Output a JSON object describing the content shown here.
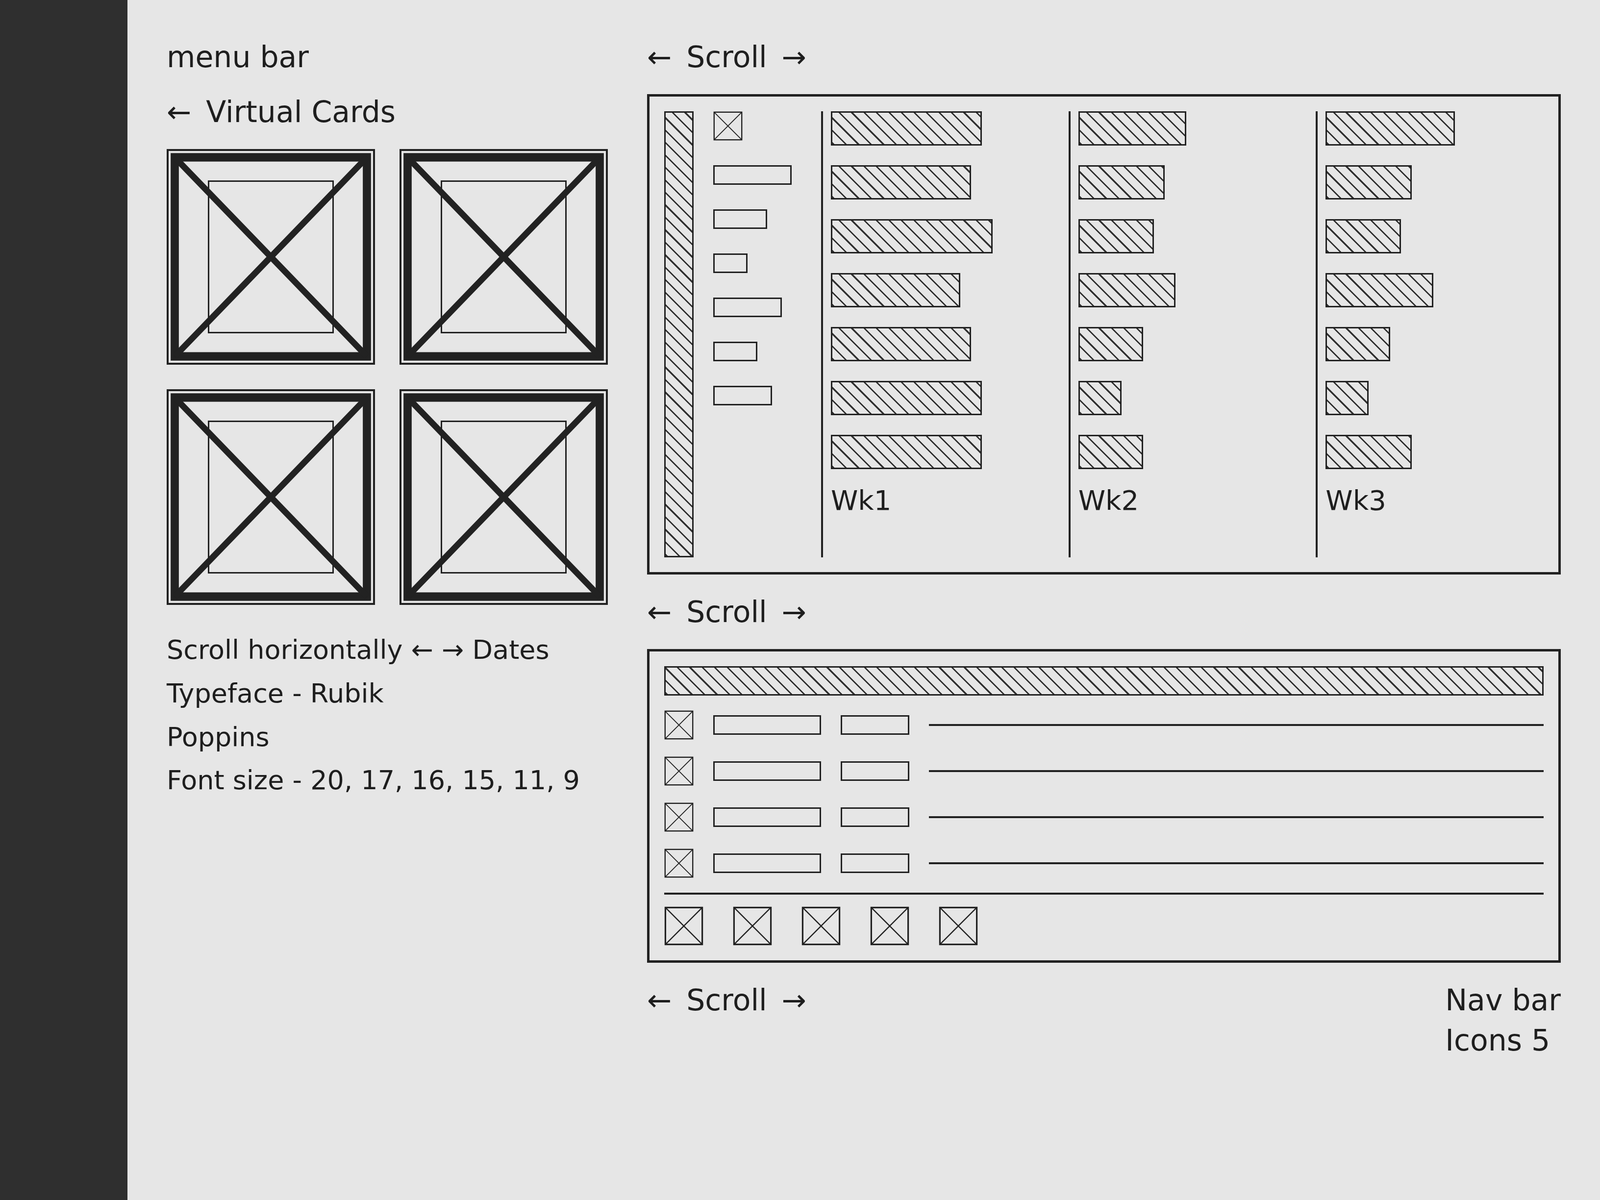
{
  "labels": {
    "menu_bar": "menu bar",
    "virtual_cards": "Virtual Cards",
    "virtual_cards_arrow": "←"
  },
  "notes": [
    {
      "text": "Scroll horizontally ← → Dates"
    },
    {
      "text": "Typeface - Rubik"
    },
    {
      "text": "Poppins"
    },
    {
      "text": "Font size - 20, 17, 16, 15, 11, 9"
    }
  ],
  "top_scroll": {
    "left": "←",
    "label": "Scroll",
    "right": "→"
  },
  "chart_screen": {
    "weeks": [
      {
        "label": "Wk1",
        "values": [
          7,
          6.5,
          7.5,
          6,
          6.5,
          7,
          7
        ]
      },
      {
        "label": "Wk2",
        "values": [
          5,
          4,
          3.5,
          4.5,
          3,
          2,
          3
        ]
      },
      {
        "label": "Wk3",
        "values": [
          6,
          4,
          3.5,
          5,
          3,
          2,
          4
        ]
      }
    ],
    "scroll": {
      "left": "←",
      "label": "Scroll",
      "right": "→"
    }
  },
  "list_screen": {
    "scroll": {
      "left": "←",
      "label": "Scroll",
      "right": "→"
    },
    "nav_bar": "Nav bar",
    "nav_icons": "Icons 5"
  }
}
